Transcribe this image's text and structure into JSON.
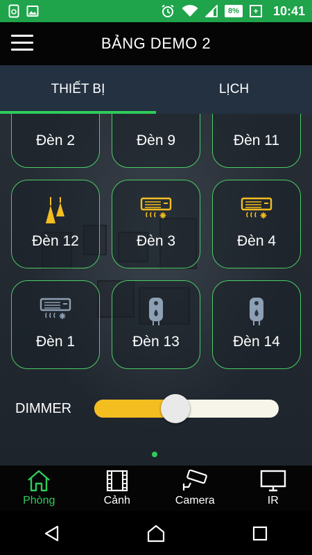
{
  "status_bar": {
    "time": "10:41",
    "battery_percent": "8%",
    "icons": [
      "app-notification-icon",
      "image-notification-icon",
      "alarm-icon",
      "wifi-icon",
      "signal-icon",
      "battery-icon"
    ]
  },
  "app_bar": {
    "title": "BẢNG DEMO 2",
    "menu_icon": "hamburger-menu-icon"
  },
  "tabs": [
    {
      "label": "THIẾT BỊ",
      "active": true
    },
    {
      "label": "LỊCH",
      "active": false
    }
  ],
  "devices": [
    {
      "label": "Đèn 2",
      "icon": "ceiling-lights-icon",
      "color": "#f4bd20",
      "partial": true
    },
    {
      "label": "Đèn 9",
      "icon": "ceiling-lights-icon",
      "color": "#f4bd20",
      "partial": true
    },
    {
      "label": "Đèn 11",
      "icon": "pendant-lamp-icon",
      "color": "#f4bd20",
      "partial": true
    },
    {
      "label": "Đèn 12",
      "icon": "pendant-lamp-icon",
      "color": "#f4bd20"
    },
    {
      "label": "Đèn 3",
      "icon": "air-conditioner-icon",
      "color": "#f4bd20"
    },
    {
      "label": "Đèn 4",
      "icon": "air-conditioner-icon",
      "color": "#f4bd20"
    },
    {
      "label": "Đèn 1",
      "icon": "air-conditioner-icon",
      "color": "#8ea0b4"
    },
    {
      "label": "Đèn 13",
      "icon": "water-heater-icon",
      "color": "#8ea0b4"
    },
    {
      "label": "Đèn 14",
      "icon": "water-heater-icon",
      "color": "#8ea0b4"
    }
  ],
  "dimmer": {
    "label": "DIMMER",
    "value_fraction": 0.44
  },
  "pager": {
    "pages": 1,
    "current": 1
  },
  "bottom_nav": [
    {
      "label": "Phòng",
      "icon": "home-icon",
      "active": true
    },
    {
      "label": "Cảnh",
      "icon": "film-icon",
      "active": false
    },
    {
      "label": "Camera",
      "icon": "security-camera-icon",
      "active": false
    },
    {
      "label": "IR",
      "icon": "tv-icon",
      "active": false
    }
  ],
  "colors": {
    "accent": "#2ecc5a",
    "status_bar": "#1fa34b",
    "tab_bar": "#233141",
    "device_on": "#f4bd20",
    "device_off": "#8ea0b4",
    "slider_fill": "#f4bd20"
  }
}
